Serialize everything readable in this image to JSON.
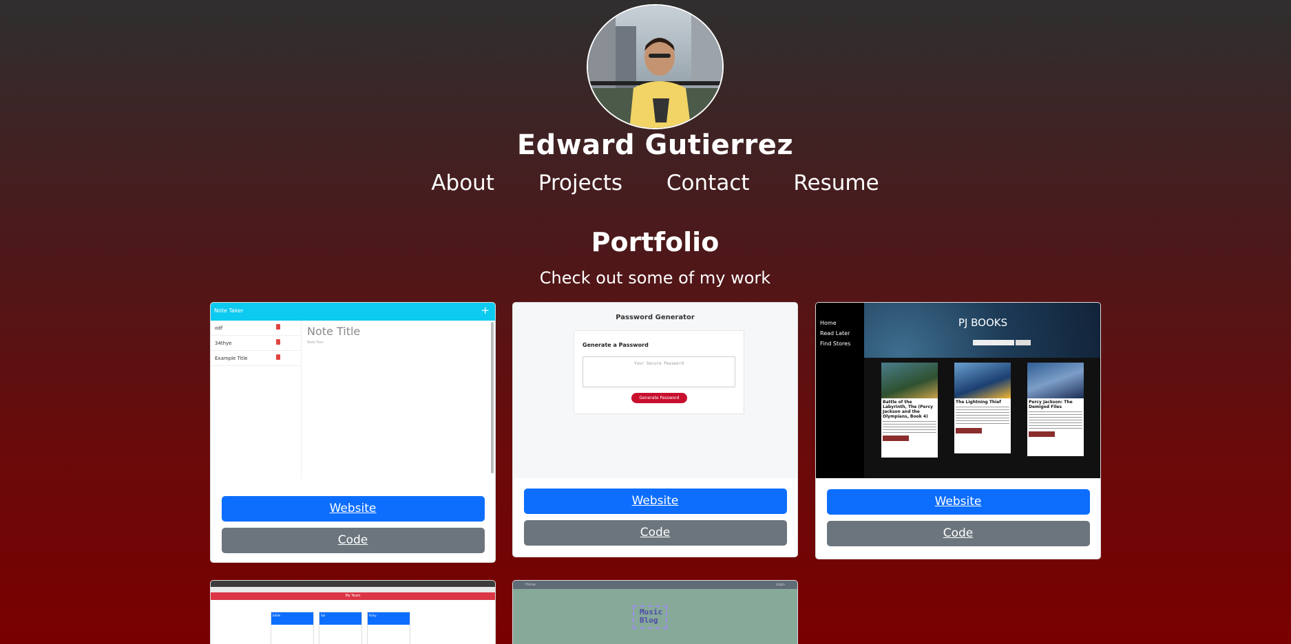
{
  "profile": {
    "name": "Edward Gutierrez"
  },
  "nav": {
    "items": [
      "About",
      "Projects",
      "Contact",
      "Resume"
    ]
  },
  "portfolio": {
    "title": "Portfolio",
    "subtitle": "Check out some of my work"
  },
  "buttons": {
    "website": "Website",
    "code": "Code"
  },
  "projects": {
    "note_taker": {
      "app_title": "Note Taker",
      "notes": [
        "odf",
        "34thye",
        "Example Title"
      ],
      "note_title_placeholder": "Note Title",
      "note_text_placeholder": "Note Text"
    },
    "password_generator": {
      "heading": "Password Generator",
      "card_title": "Generate a Password",
      "textarea_placeholder": "Your Secure Password",
      "button": "Generate Password"
    },
    "pj_books": {
      "title": "PJ BOOKS",
      "menu": [
        "Home",
        "Read Later",
        "Find Stores"
      ],
      "books": [
        "Battle of the Labyrinth, The (Percy Jackson and the Olympians, Book 4)",
        "The Lightning Thief",
        "Percy Jackson: The Demigod Files"
      ]
    },
    "my_team": {
      "bar_title": "My Team",
      "members": [
        "Eddie",
        "Sal",
        "Ricky"
      ]
    },
    "music_blog": {
      "logo": "Music Blog",
      "nav_left": "Home",
      "nav_right": "Login"
    }
  },
  "colors": {
    "primary": "#0d6efd",
    "secondary": "#6c757d",
    "note_bar": "#0dcaf0",
    "generate": "#c8102e",
    "team_bar": "#dc3545",
    "blog_bg": "#86a99a"
  }
}
